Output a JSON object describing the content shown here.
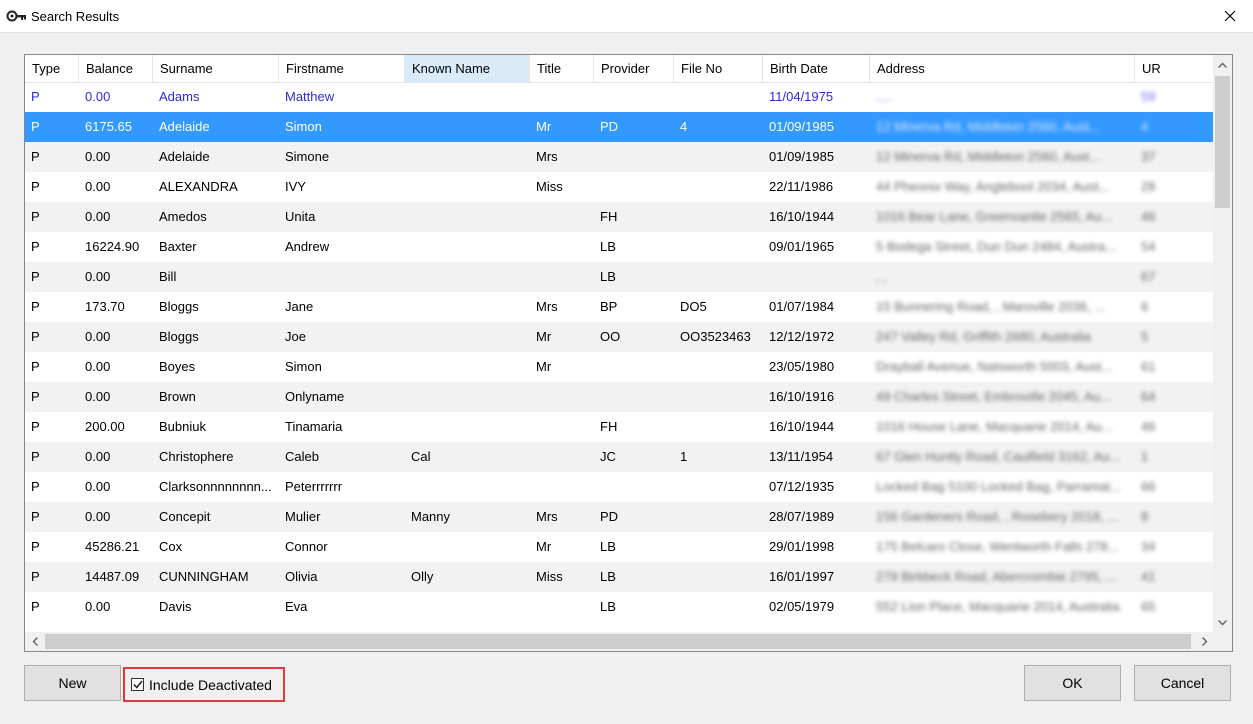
{
  "window": {
    "title": "Search Results",
    "close_glyph": "✕"
  },
  "columns": [
    "Type",
    "Balance",
    "Surname",
    "Firstname",
    "Known Name",
    "Title",
    "Provider",
    "File No",
    "Birth Date",
    "Address",
    "UR"
  ],
  "rows": [
    {
      "type": "P",
      "balance": "0.00",
      "surname": "Adams",
      "firstname": "Matthew",
      "known": "",
      "title": "",
      "provider": "",
      "file": "",
      "birth": "11/04/1975",
      "address": "....",
      "ur": "59",
      "state": "deactivated"
    },
    {
      "type": "P",
      "balance": "6175.65",
      "surname": "Adelaide",
      "firstname": "Simon",
      "known": "",
      "title": "Mr",
      "provider": "PD",
      "file": "4",
      "birth": "01/09/1985",
      "address": "12 Minerva Rd, Middleton 2560, Aust...",
      "ur": "4",
      "state": "selected"
    },
    {
      "type": "P",
      "balance": "0.00",
      "surname": "Adelaide",
      "firstname": "Simone",
      "known": "",
      "title": "Mrs",
      "provider": "",
      "file": "",
      "birth": "01/09/1985",
      "address": "12 Minerva Rd, Middleton 2560, Aust...",
      "ur": "37",
      "state": ""
    },
    {
      "type": "P",
      "balance": "0.00",
      "surname": "ALEXANDRA",
      "firstname": "IVY",
      "known": "",
      "title": "Miss",
      "provider": "",
      "file": "",
      "birth": "22/11/1986",
      "address": "44 Pheonix Way, Anglebool 2034, Aust...",
      "ur": "28",
      "state": ""
    },
    {
      "type": "P",
      "balance": "0.00",
      "surname": "Amedos",
      "firstname": "Unita",
      "known": "",
      "title": "",
      "provider": "FH",
      "file": "",
      "birth": "16/10/1944",
      "address": "1016 Bear Lane, Greenvantle 2565, Au...",
      "ur": "46",
      "state": ""
    },
    {
      "type": "P",
      "balance": "16224.90",
      "surname": "Baxter",
      "firstname": "Andrew",
      "known": "",
      "title": "",
      "provider": "LB",
      "file": "",
      "birth": "09/01/1965",
      "address": "5 Bodega Street, Dun Dun 2484, Austra...",
      "ur": "54",
      "state": ""
    },
    {
      "type": "P",
      "balance": "0.00",
      "surname": "Bill",
      "firstname": "",
      "known": "",
      "title": "",
      "provider": "LB",
      "file": "",
      "birth": "",
      "address": ", ,",
      "ur": "67",
      "state": ""
    },
    {
      "type": "P",
      "balance": "173.70",
      "surname": "Bloggs",
      "firstname": "Jane",
      "known": "",
      "title": "Mrs",
      "provider": "BP",
      "file": "DO5",
      "birth": "01/07/1984",
      "address": "15 Bunnering Road, , Maroville 2036, ...",
      "ur": "6",
      "state": ""
    },
    {
      "type": "P",
      "balance": "0.00",
      "surname": "Bloggs",
      "firstname": "Joe",
      "known": "",
      "title": "Mr",
      "provider": "OO",
      "file": "OO3523463",
      "birth": "12/12/1972",
      "address": "247 Valley Rd, Griffith 2680, Australia",
      "ur": "5",
      "state": ""
    },
    {
      "type": "P",
      "balance": "0.00",
      "surname": "Boyes",
      "firstname": "Simon",
      "known": "",
      "title": "Mr",
      "provider": "",
      "file": "",
      "birth": "23/05/1980",
      "address": "Drayball Avenue, Natsworth 5003, Aust...",
      "ur": "61",
      "state": ""
    },
    {
      "type": "P",
      "balance": "0.00",
      "surname": "Brown",
      "firstname": "Onlyname",
      "known": "",
      "title": "",
      "provider": "",
      "file": "",
      "birth": "16/10/1916",
      "address": "49 Charles Street, Embroville 2045, Au...",
      "ur": "64",
      "state": ""
    },
    {
      "type": "P",
      "balance": "200.00",
      "surname": "Bubniuk",
      "firstname": "Tinamaria",
      "known": "",
      "title": "",
      "provider": "FH",
      "file": "",
      "birth": "16/10/1944",
      "address": "1016 House Lane, Macquarie 2014, Au...",
      "ur": "46",
      "state": ""
    },
    {
      "type": "P",
      "balance": "0.00",
      "surname": "Christophere",
      "firstname": "Caleb",
      "known": "Cal",
      "title": "",
      "provider": "JC",
      "file": "1",
      "birth": "13/11/1954",
      "address": "67 Glen Huntly Road, Caulfield 3162, Au...",
      "ur": "1",
      "state": ""
    },
    {
      "type": "P",
      "balance": "0.00",
      "surname": "Clarksonnnnnnnn...",
      "firstname": "Peterrrrrrr",
      "known": "",
      "title": "",
      "provider": "",
      "file": "",
      "birth": "07/12/1935",
      "address": "Locked Bag 5100 Locked Bag, Parramat...",
      "ur": "66",
      "state": ""
    },
    {
      "type": "P",
      "balance": "0.00",
      "surname": "Concepit",
      "firstname": "Mulier",
      "known": "Manny",
      "title": "Mrs",
      "provider": "PD",
      "file": "",
      "birth": "28/07/1989",
      "address": "156 Gardeners Road, , Rosebery 2018, ...",
      "ur": "8",
      "state": ""
    },
    {
      "type": "P",
      "balance": "45286.21",
      "surname": "Cox",
      "firstname": "Connor",
      "known": "",
      "title": "Mr",
      "provider": "LB",
      "file": "",
      "birth": "29/01/1998",
      "address": "175 Belcaro Close, Wentworth Falls 278...",
      "ur": "34",
      "state": ""
    },
    {
      "type": "P",
      "balance": "14487.09",
      "surname": "CUNNINGHAM",
      "firstname": "Olivia",
      "known": "Olly",
      "title": "Miss",
      "provider": "LB",
      "file": "",
      "birth": "16/01/1997",
      "address": "279 Birkbeck Road, Abercrombie 2795, ...",
      "ur": "41",
      "state": ""
    },
    {
      "type": "P",
      "balance": "0.00",
      "surname": "Davis",
      "firstname": "Eva",
      "known": "",
      "title": "",
      "provider": "LB",
      "file": "",
      "birth": "02/05/1979",
      "address": "552 Lion Place, Macquarie 2014, Australia",
      "ur": "65",
      "state": ""
    }
  ],
  "buttons": {
    "new": "New",
    "ok": "OK",
    "cancel": "Cancel"
  },
  "checkbox": {
    "label": "Include Deactivated",
    "checked": true
  },
  "colors": {
    "selection": "#3399ff",
    "deactivated_text": "#2b2bd8",
    "highlight_border": "#e03a3e"
  }
}
